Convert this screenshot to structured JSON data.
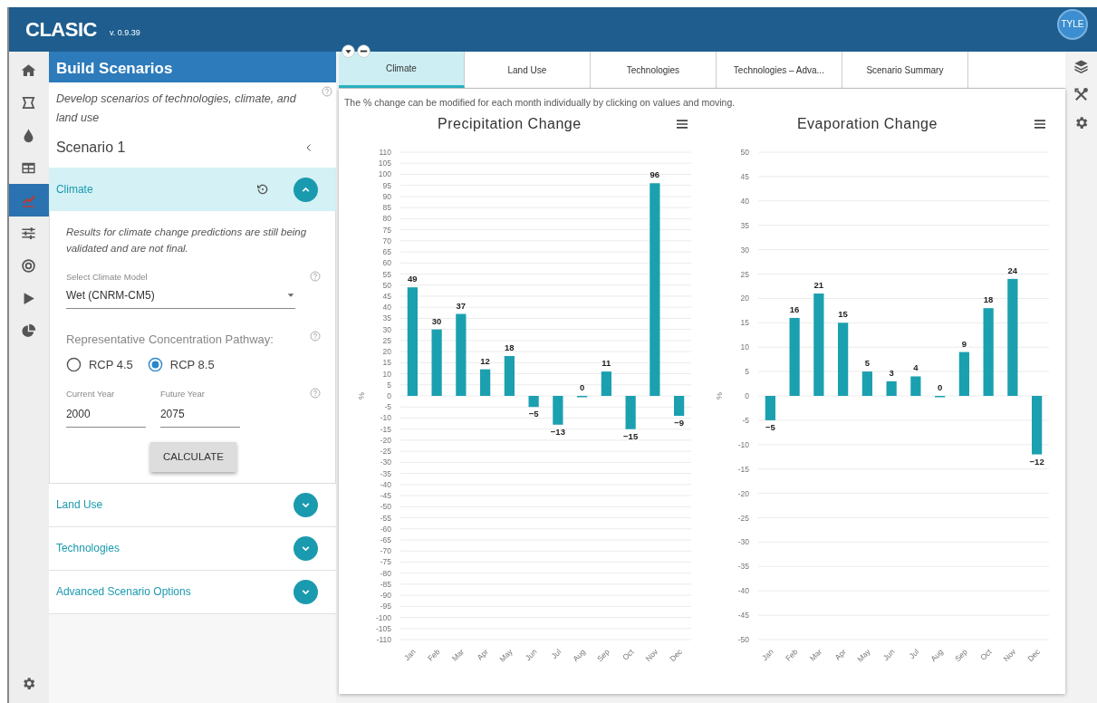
{
  "app": {
    "title": "CLASIC",
    "version": "v. 0.9.39",
    "user": "TYLE"
  },
  "rail": {
    "items": [
      {
        "selected": false
      },
      {
        "selected": false
      },
      {
        "selected": false
      },
      {
        "selected": false
      },
      {
        "selected": true
      },
      {
        "selected": false
      },
      {
        "selected": false
      },
      {
        "selected": false
      },
      {
        "selected": false
      }
    ]
  },
  "panel": {
    "title": "Build Scenarios",
    "description": "Develop scenarios of technologies, climate, and land use",
    "scenario": "Scenario 1",
    "sections": [
      {
        "label": "Climate",
        "expanded": true,
        "form": {
          "note": "Results for climate change predictions are still being validated and are not final.",
          "model": {
            "label": "Select Climate Model",
            "value": "Wet (CNRM-CM5)"
          },
          "rcp": {
            "label": "Representative Concentration Pathway:",
            "options": [
              {
                "label": "RCP 4.5",
                "selected": false
              },
              {
                "label": "RCP 8.5",
                "selected": true
              }
            ]
          },
          "years": [
            {
              "label": "Current Year",
              "value": "2000"
            },
            {
              "label": "Future Year",
              "value": "2075"
            }
          ],
          "button": "CALCULATE"
        }
      },
      {
        "label": "Land Use",
        "expanded": false
      },
      {
        "label": "Technologies",
        "expanded": false
      },
      {
        "label": "Advanced Scenario Options",
        "expanded": false
      }
    ]
  },
  "tabs": [
    {
      "label": "Climate",
      "selected": true
    },
    {
      "label": "Land Use",
      "selected": false
    },
    {
      "label": "Technologies",
      "selected": false
    },
    {
      "label": "Technologies – Adva...",
      "selected": false
    },
    {
      "label": "Scenario Summary",
      "selected": false
    }
  ],
  "hint": "The % change can be modified for each month individually by clicking on values and moving.",
  "charts": [
    {
      "chart_data": {
        "type": "bar",
        "title": "Precipitation Change",
        "ylabel": "%",
        "categories": [
          "Jan",
          "Feb",
          "Mar",
          "Apr",
          "May",
          "Jun",
          "Jul",
          "Aug",
          "Sep",
          "Oct",
          "Nov",
          "Dec"
        ],
        "grid": true,
        "series": [
          {
            "color": "#1ba0b0",
            "values": [
              49,
              30,
              37,
              12,
              18,
              -5,
              -13,
              0,
              11,
              -15,
              96,
              -9
            ]
          }
        ],
        "ylim": [
          -110,
          110
        ],
        "yticks": [
          110,
          105,
          100,
          95,
          90,
          85,
          80,
          75,
          70,
          65,
          60,
          55,
          50,
          45,
          40,
          35,
          30,
          25,
          20,
          15,
          10,
          5,
          0,
          -5,
          -10,
          -15,
          -20,
          -25,
          -30,
          -35,
          -40,
          -45,
          -50,
          -55,
          -60,
          -65,
          -70,
          -75,
          -80,
          -85,
          -90,
          -95,
          -100,
          -105,
          -110
        ],
        "data_labels": true
      }
    },
    {
      "chart_data": {
        "type": "bar",
        "title": "Evaporation Change",
        "ylabel": "%",
        "categories": [
          "Jan",
          "Feb",
          "Mar",
          "Apr",
          "May",
          "Jun",
          "Jul",
          "Aug",
          "Sep",
          "Oct",
          "Nov",
          "Dec"
        ],
        "grid": true,
        "series": [
          {
            "color": "#1ba0b0",
            "values": [
              -5,
              16,
              21,
              15,
              5,
              3,
              4,
              0,
              9,
              18,
              24,
              -12
            ]
          }
        ],
        "ylim": [
          -50,
          50
        ],
        "yticks": [
          50,
          45,
          40,
          35,
          30,
          25,
          20,
          15,
          10,
          5,
          0,
          -5,
          -10,
          -15,
          -20,
          -25,
          -30,
          -35,
          -40,
          -45,
          -50
        ],
        "data_labels": true
      }
    }
  ]
}
